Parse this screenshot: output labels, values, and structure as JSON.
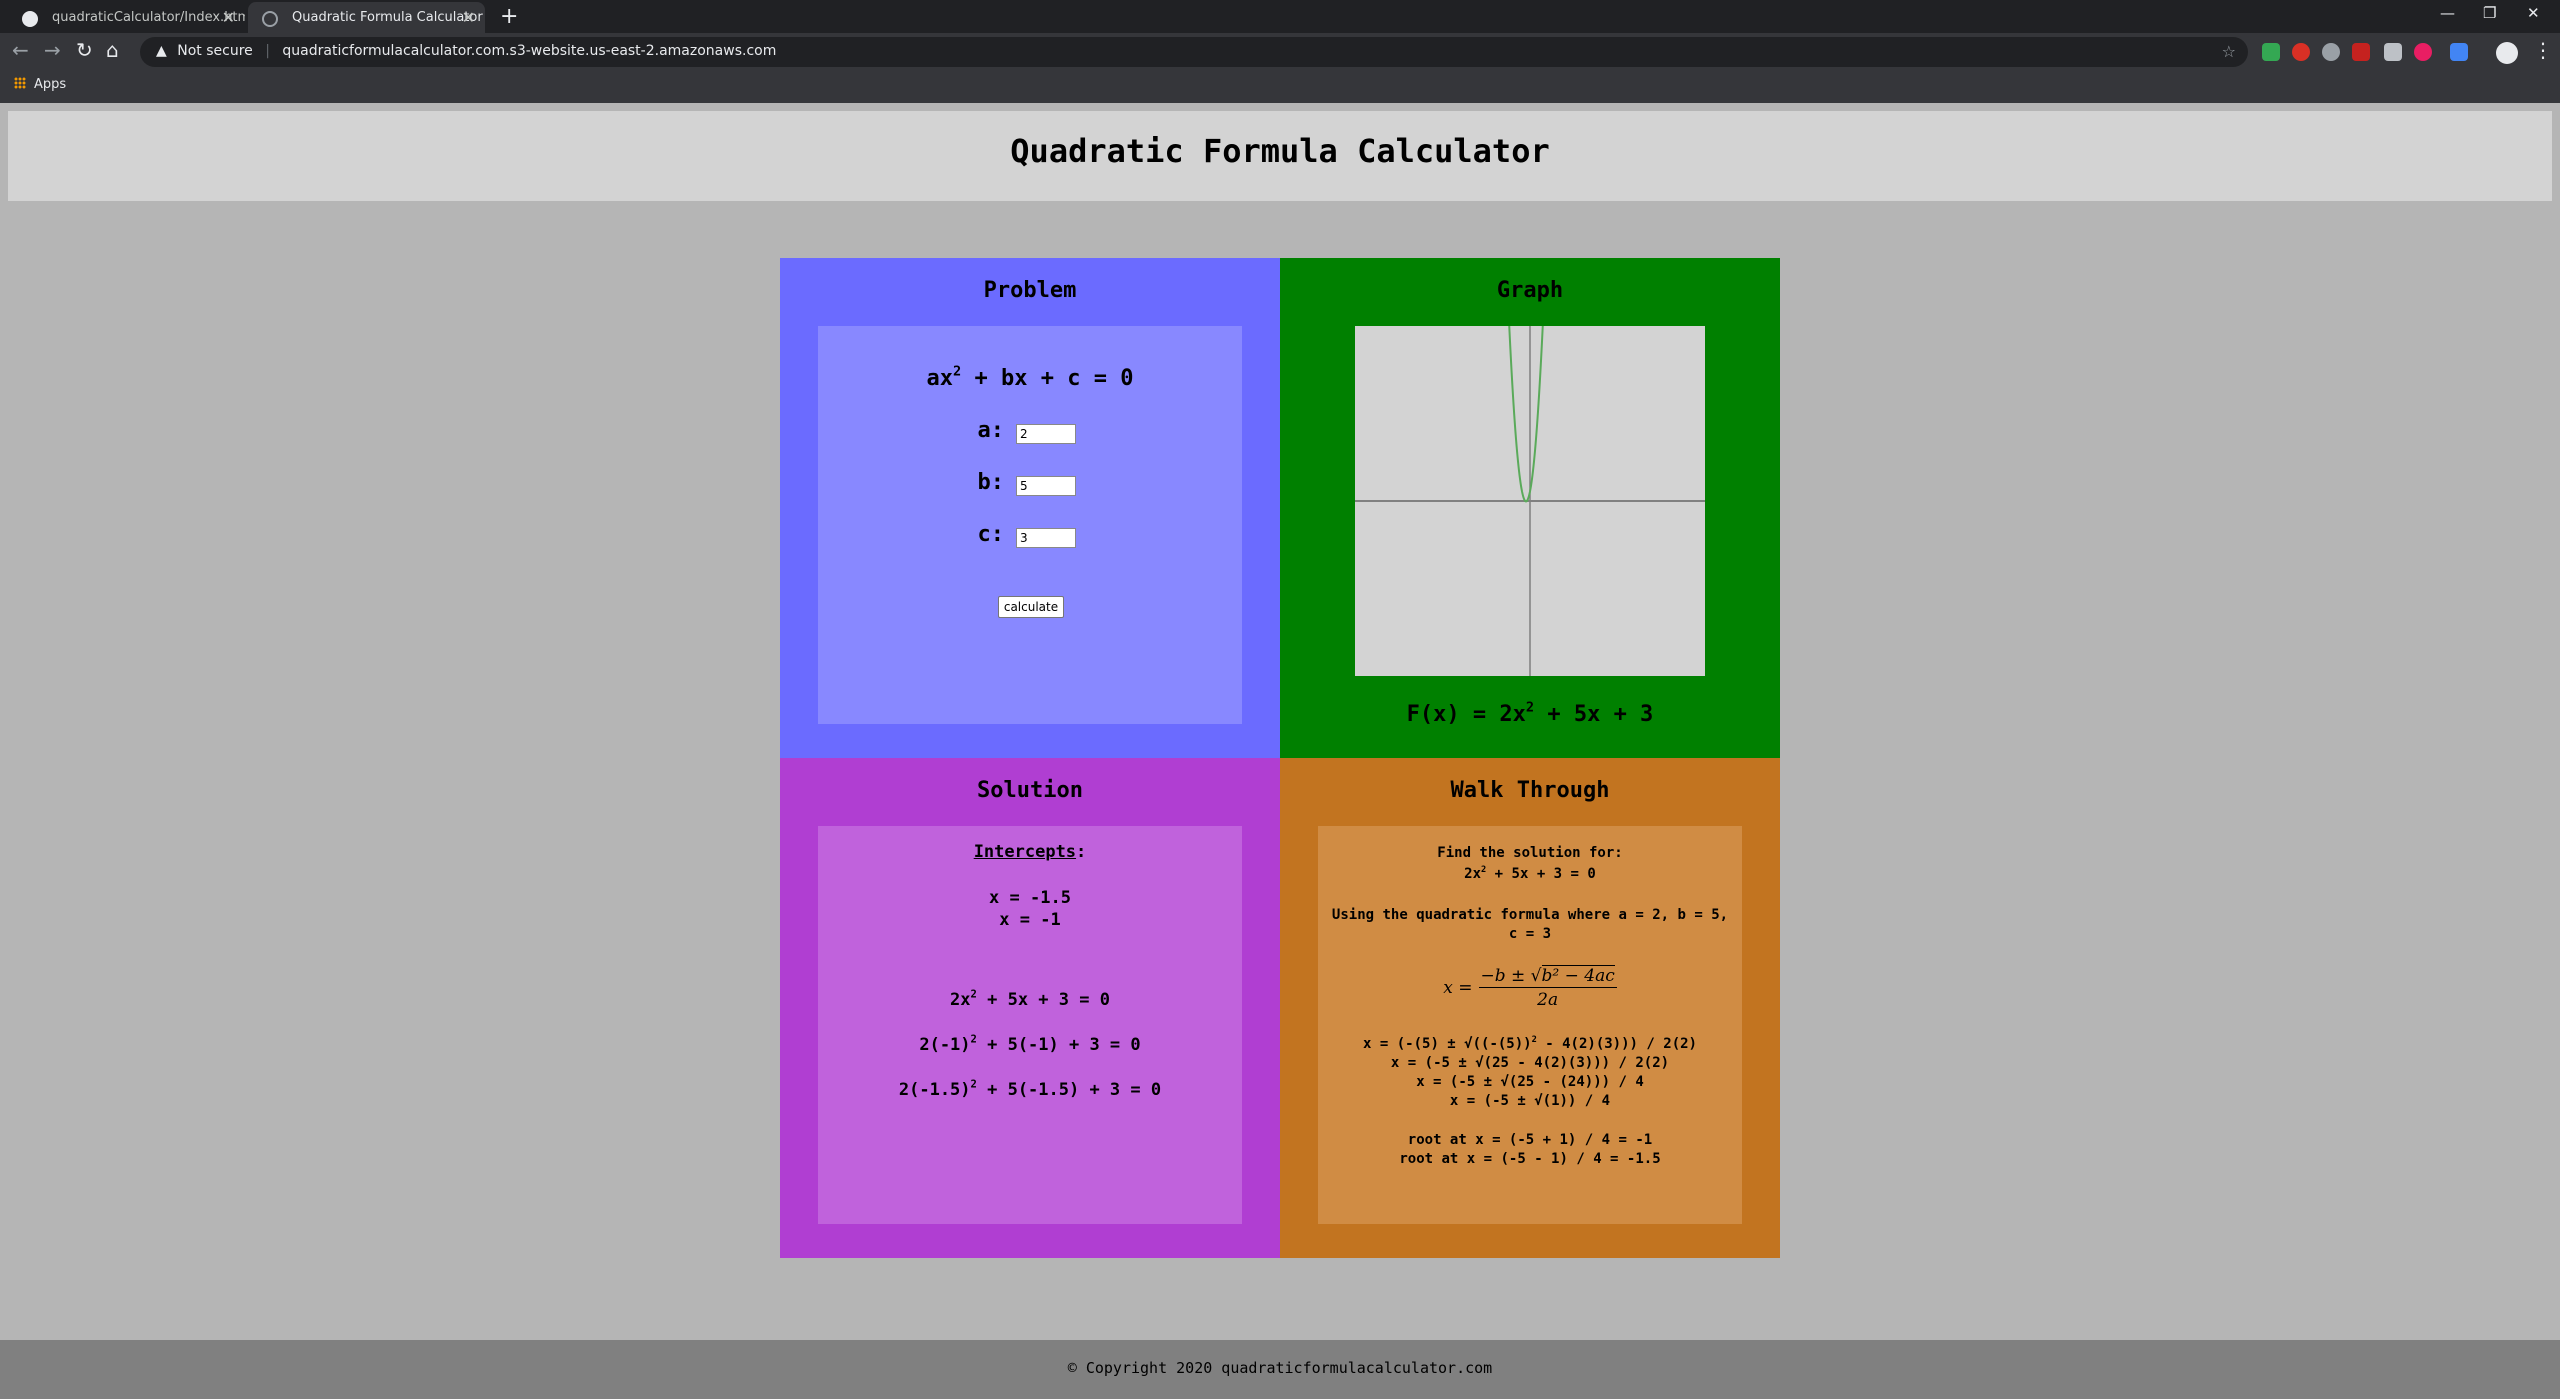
{
  "browser": {
    "tabs": [
      {
        "title": "quadraticCalculator/Index.html at",
        "active": false
      },
      {
        "title": "Quadratic Formula Calculator",
        "active": true
      }
    ],
    "new_tab_icon": "+",
    "security_label": "Not secure",
    "url": "quadraticformulacalculator.com.s3-website.us-east-2.amazonaws.com",
    "bookmarks": [
      {
        "label": "Apps"
      }
    ]
  },
  "page": {
    "title": "Quadratic Formula Calculator",
    "problem": {
      "heading": "Problem",
      "equation_parts": [
        "ax",
        "2",
        " + bx + c = 0"
      ],
      "fields": [
        {
          "label": "a:",
          "value": "2"
        },
        {
          "label": "b:",
          "value": "5"
        },
        {
          "label": "c:",
          "value": "3"
        }
      ],
      "button_label": "calculate"
    },
    "graph": {
      "heading": "Graph",
      "function_parts": [
        "F(x) = 2x",
        "2",
        " + 5x + 3"
      ],
      "curve_color": "#5aaa5a",
      "axis_color": "#808080"
    },
    "solution": {
      "intercepts_label": "Intercepts",
      "intercepts_colon": ":",
      "intercepts": [
        "x = -1.5",
        "x = -1"
      ],
      "checks": [
        {
          "base": "2x",
          "exp": "2",
          "rest": " + 5x + 3 = 0"
        },
        {
          "base": "2(-1)",
          "exp": "2",
          "rest": " + 5(-1) + 3 = 0"
        },
        {
          "base": "2(-1.5)",
          "exp": "2",
          "rest": " + 5(-1.5) + 3 = 0"
        }
      ]
    },
    "walkthrough": {
      "heading": "Walk Through",
      "find_label": "Find the solution for:",
      "equation": {
        "base": "2x",
        "exp": "2",
        "rest": " + 5x + 3 = 0"
      },
      "using_line1": "Using the quadratic formula where a = 2, b = 5,",
      "using_line2": "c = 3",
      "formula": {
        "lhs": "x =",
        "numerator_prefix": "−b ± √",
        "radicand": "b² − 4ac",
        "denominator": "2a"
      },
      "steps": [
        {
          "pre": "x = (-(5) ± √((-(5))",
          "exp": "2",
          "post": " - 4(2)(3))) / 2(2)"
        },
        {
          "pre": "x = (-5 ± √(25 - 4(2)(3))) / 2(2)",
          "exp": "",
          "post": ""
        },
        {
          "pre": "x = (-5 ± √(25 - (24))) / 4",
          "exp": "",
          "post": ""
        },
        {
          "pre": "x = (-5 ± √(1)) / 4",
          "exp": "",
          "post": ""
        }
      ],
      "roots": [
        "root at x = (-5 + 1) / 4 = -1",
        "root at x = (-5 - 1) / 4 = -1.5"
      ]
    },
    "footer": "© Copyright 2020 quadraticformulacalculator.com"
  }
}
